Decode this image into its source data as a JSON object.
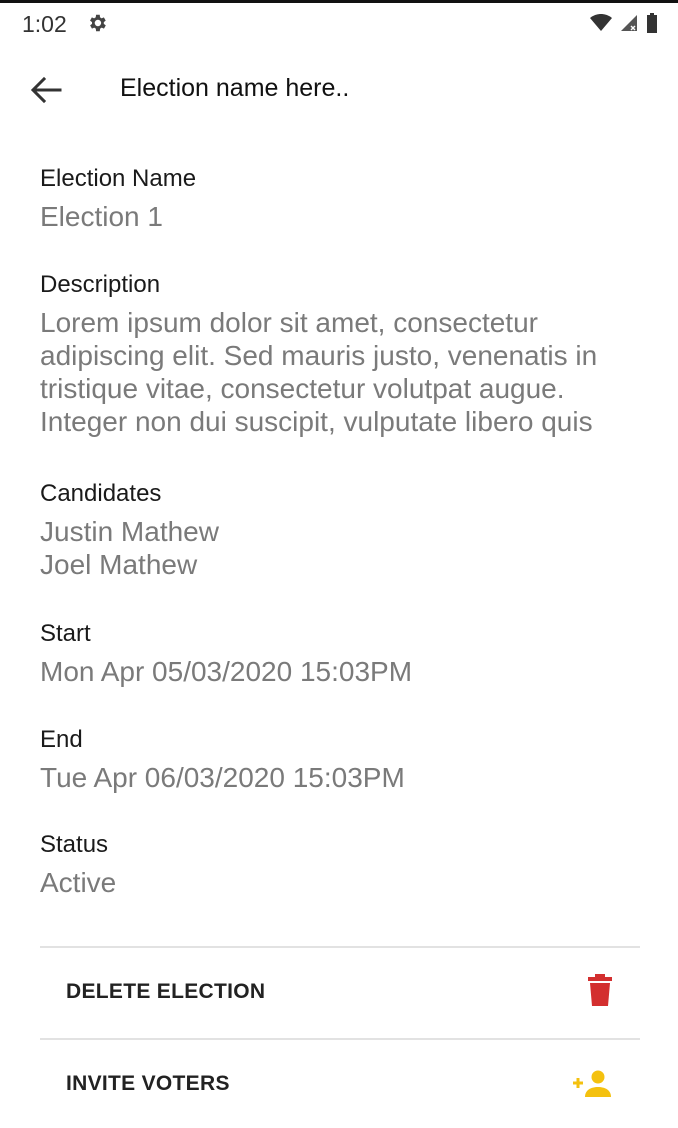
{
  "status_bar": {
    "time": "1:02",
    "icons": [
      "gear-icon",
      "wifi-icon",
      "signal-icon",
      "battery-icon"
    ]
  },
  "app_bar": {
    "title": "Election name here..",
    "back_icon": "arrow-back-icon"
  },
  "fields": {
    "election_name": {
      "label": "Election Name",
      "value": "Election 1"
    },
    "description": {
      "label": "Description",
      "lines": [
        "Lorem ipsum dolor sit amet, consectetur",
        "adipiscing elit. Sed mauris justo, venenatis in",
        "tristique vitae, consectetur volutpat augue.",
        "Integer non dui suscipit, vulputate libero quis"
      ]
    },
    "candidates": {
      "label": "Candidates",
      "items": [
        "Justin Mathew",
        "Joel Mathew"
      ]
    },
    "start": {
      "label": "Start",
      "value": "Mon Apr 05/03/2020 15:03PM"
    },
    "end": {
      "label": "End",
      "value": "Tue Apr 06/03/2020 15:03PM"
    },
    "status": {
      "label": "Status",
      "value": "Active"
    }
  },
  "actions": {
    "delete": {
      "label": "DELETE ELECTION",
      "icon": "trash-icon",
      "color": "#d32f2f"
    },
    "invite": {
      "label": "INVITE VOTERS",
      "icon": "add-person-icon",
      "color": "#f4c10f"
    }
  },
  "colors": {
    "label_text": "#1a1a1a",
    "value_text": "#7a7a7a",
    "divider": "#e2e2e2"
  }
}
